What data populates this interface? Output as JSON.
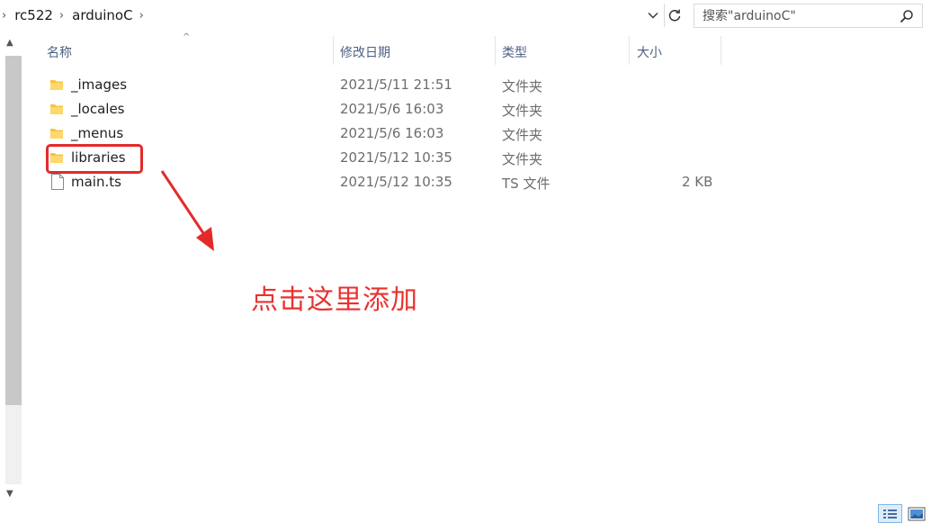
{
  "breadcrumb": {
    "items": [
      "rc522",
      "arduinoC"
    ]
  },
  "search": {
    "placeholder": "搜索\"arduinoC\""
  },
  "columns": {
    "name": "名称",
    "modified": "修改日期",
    "type": "类型",
    "size": "大小"
  },
  "files": [
    {
      "name": "_images",
      "modified": "2021/5/11 21:51",
      "type": "文件夹",
      "size": "",
      "kind": "folder"
    },
    {
      "name": "_locales",
      "modified": "2021/5/6 16:03",
      "type": "文件夹",
      "size": "",
      "kind": "folder"
    },
    {
      "name": "_menus",
      "modified": "2021/5/6 16:03",
      "type": "文件夹",
      "size": "",
      "kind": "folder"
    },
    {
      "name": "libraries",
      "modified": "2021/5/12 10:35",
      "type": "文件夹",
      "size": "",
      "kind": "folder"
    },
    {
      "name": "main.ts",
      "modified": "2021/5/12 10:35",
      "type": "TS 文件",
      "size": "2 KB",
      "kind": "file"
    }
  ],
  "annotation": {
    "text": "点击这里添加",
    "color": "#e9322f"
  },
  "colors": {
    "folder": "#f5c342",
    "header_text": "#4d6082",
    "highlight": "#e32a2a"
  }
}
